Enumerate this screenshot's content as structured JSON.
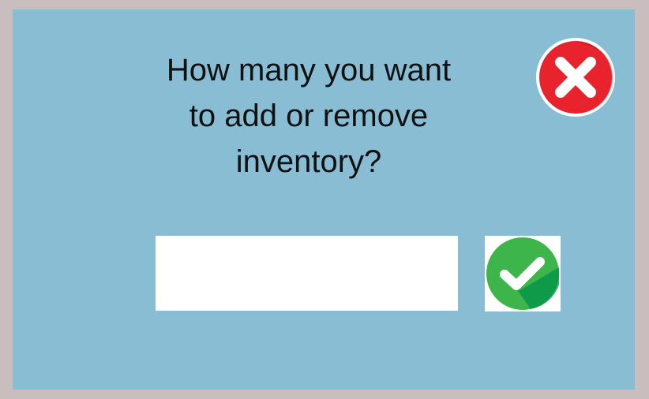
{
  "dialog": {
    "prompt_line1": "How many you want",
    "prompt_line2": "to add or remove",
    "prompt_line3": "inventory?",
    "quantity": {
      "value": "",
      "placeholder": ""
    },
    "close_icon": "close-x-icon",
    "confirm_icon": "checkmark-icon"
  },
  "colors": {
    "background": "#c9bdbd",
    "dialog": "#88bdd3",
    "close_red": "#e8232e",
    "confirm_green": "#3db54a"
  }
}
